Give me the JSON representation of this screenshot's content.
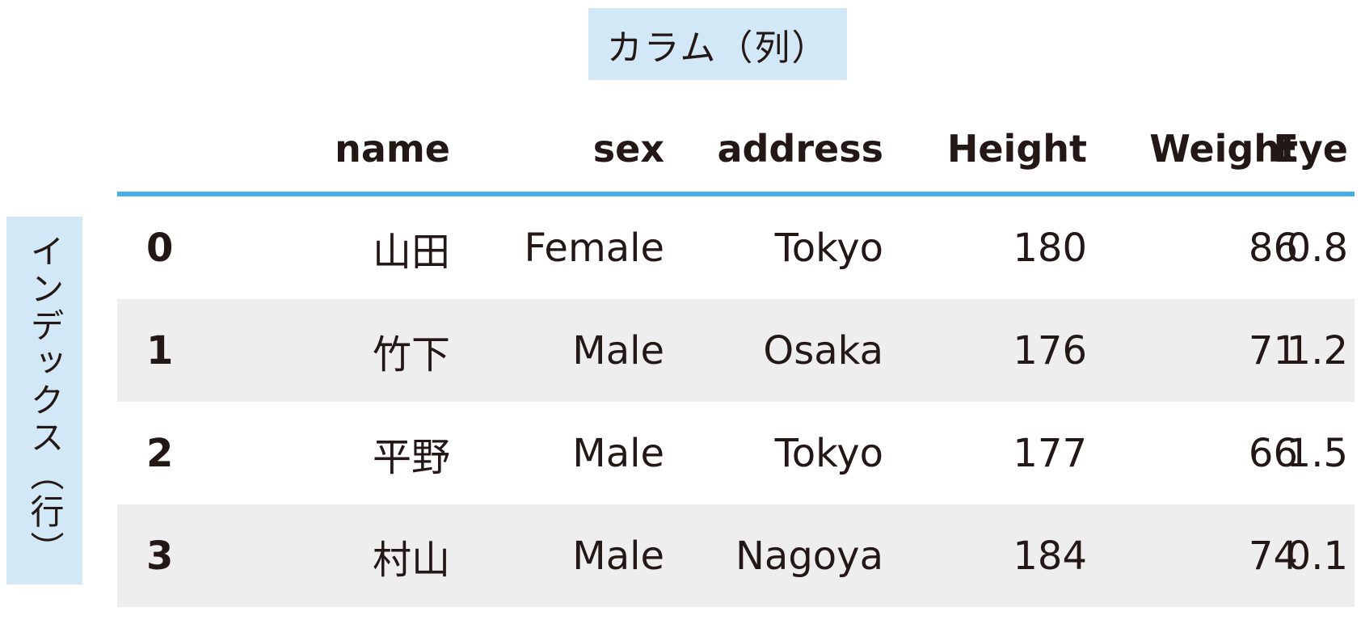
{
  "column_label": "カラム（列）",
  "index_label": "インデックス（行）",
  "table": {
    "headers": [
      "",
      "name",
      "sex",
      "address",
      "Height",
      "Weight",
      "Eye"
    ],
    "rows": [
      {
        "index": "0",
        "name": "山田",
        "sex": "Female",
        "address": "Tokyo",
        "height": "180",
        "weight": "86",
        "eye": "0.8"
      },
      {
        "index": "1",
        "name": "竹下",
        "sex": "Male",
        "address": "Osaka",
        "height": "176",
        "weight": "71",
        "eye": "1.2"
      },
      {
        "index": "2",
        "name": "平野",
        "sex": "Male",
        "address": "Tokyo",
        "height": "177",
        "weight": "66",
        "eye": "1.5"
      },
      {
        "index": "3",
        "name": "村山",
        "sex": "Male",
        "address": "Nagoya",
        "height": "184",
        "weight": "74",
        "eye": "0.1"
      }
    ]
  },
  "colors": {
    "label_background": "#d3e8f7",
    "header_rule": "#47b0e8",
    "alt_row": "#eeeeee",
    "text": "#231815"
  }
}
